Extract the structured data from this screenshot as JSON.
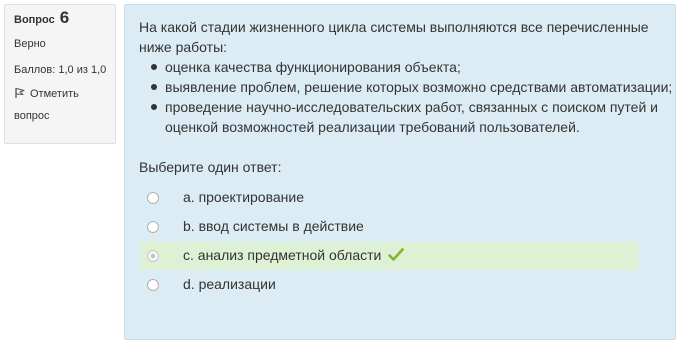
{
  "question": {
    "label": "Вопрос",
    "number": "6",
    "state": "Верно",
    "grade": "Баллов: 1,0 из 1,0",
    "flag_line1": "Отметить",
    "flag_line2": "вопрос",
    "flag_icon": "flag-icon"
  },
  "qtext": {
    "intro": "На какой стадии жизненного цикла системы выполняются все перечисленные ниже работы:",
    "items": [
      "оценка качества функционирования объекта;",
      "выявление проблем, решение которых возможно средствами автоматизации;",
      "проведение научно-исследовательских работ, связанных с поиском путей и оценкой возможностей реализации требований пользователей."
    ]
  },
  "prompt": "Выберите один ответ:",
  "answers": [
    {
      "text": "a. проектирование",
      "selected": false,
      "correct": false
    },
    {
      "text": "b. ввод системы в действие",
      "selected": false,
      "correct": false
    },
    {
      "text": "c. анализ предметной области",
      "selected": true,
      "correct": true
    },
    {
      "text": "d. реализации",
      "selected": false,
      "correct": false
    }
  ],
  "colors": {
    "content_bg": "#dcecf5",
    "info_bg": "#f5f5f5",
    "correct_bg": "#def1d4",
    "check": "#7db928"
  },
  "icons": {
    "correct": "check-icon"
  }
}
